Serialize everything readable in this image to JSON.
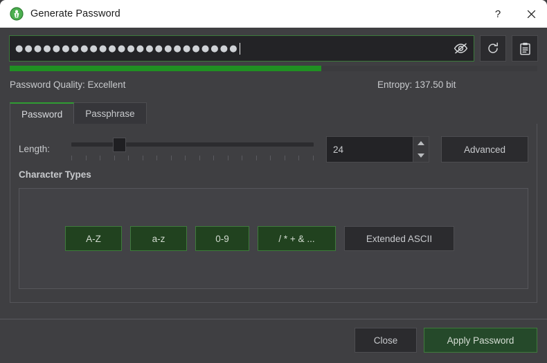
{
  "window": {
    "title": "Generate Password",
    "app_icon": "keepassxc-shield-icon",
    "help_button": "?",
    "close_button": "✕"
  },
  "password_field": {
    "masked_value": "●●●●●●●●●●●●●●●●●●●●●●●●",
    "character_count": 24,
    "toggle_visibility_icon": "eye-off-icon",
    "regenerate_icon": "refresh-icon",
    "copy_icon": "clipboard-icon"
  },
  "quality": {
    "label": "Password Quality: Excellent",
    "entropy": "Entropy: 137.50 bit",
    "bar_percent": 59,
    "bar_color": "#1f9022"
  },
  "tabs": [
    {
      "label": "Password",
      "active": true
    },
    {
      "label": "Passphrase",
      "active": false
    }
  ],
  "length": {
    "label": "Length:",
    "value": "24",
    "slider_percent": 17,
    "tick_count": 18,
    "spin_up_icon": "triangle-up-icon",
    "spin_down_icon": "triangle-down-icon"
  },
  "advanced": {
    "label": "Advanced"
  },
  "character_types": {
    "title": "Character Types",
    "buttons": [
      {
        "label": "A-Z",
        "active": true
      },
      {
        "label": "a-z",
        "active": true
      },
      {
        "label": "0-9",
        "active": true
      },
      {
        "label": "/ * + & ...",
        "active": true
      },
      {
        "label": "Extended ASCII",
        "active": false
      }
    ]
  },
  "footer": {
    "close_label": "Close",
    "apply_label": "Apply Password"
  },
  "colors": {
    "accent_green": "#2f9e32",
    "quality_green": "#1f9022",
    "window_bg": "#3f3f42",
    "field_bg": "#232326"
  }
}
